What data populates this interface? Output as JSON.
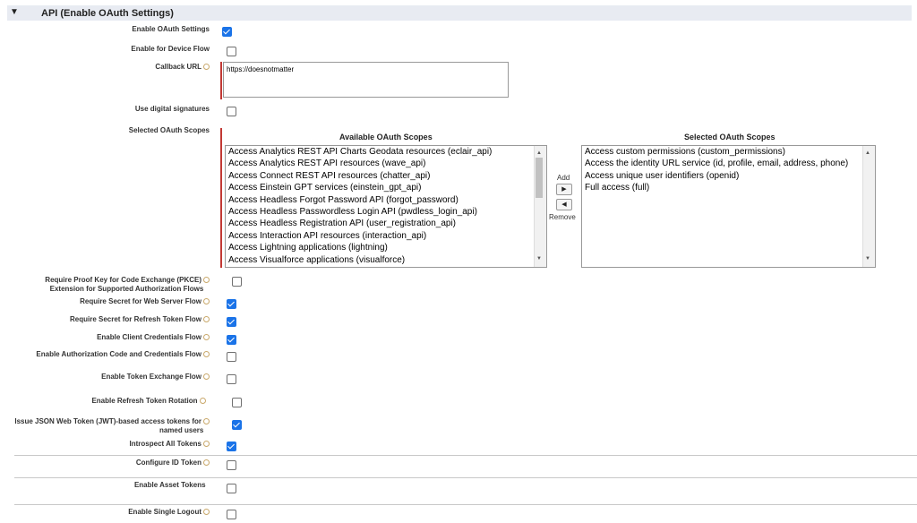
{
  "section": {
    "title": "API (Enable OAuth Settings)",
    "toggle": "▼"
  },
  "fields": {
    "enable_oauth": {
      "label": "Enable OAuth Settings",
      "checked": true
    },
    "device_flow": {
      "label": "Enable for Device Flow",
      "checked": false
    },
    "callback_url": {
      "label": "Callback URL",
      "value": "https://doesnotmatter"
    },
    "digital_sig": {
      "label": "Use digital signatures",
      "checked": false
    },
    "scopes_label": "Selected OAuth Scopes",
    "pkce": {
      "label1": "Require Proof Key for Code Exchange (PKCE)",
      "label2": "Extension for Supported Authorization Flows",
      "checked": false
    },
    "secret_web": {
      "label": "Require Secret for Web Server Flow",
      "checked": true
    },
    "secret_refresh": {
      "label": "Require Secret for Refresh Token Flow",
      "checked": true
    },
    "client_creds": {
      "label": "Enable Client Credentials Flow",
      "checked": true
    },
    "auth_code_creds": {
      "label": "Enable Authorization Code and Credentials Flow",
      "checked": false
    },
    "token_exchange": {
      "label": "Enable Token Exchange Flow",
      "checked": false
    },
    "refresh_rotation": {
      "label": "Enable Refresh Token Rotation",
      "checked": false
    },
    "jwt": {
      "label1": "Issue JSON Web Token (JWT)-based access tokens for",
      "label2": "named users",
      "checked": true
    },
    "introspect": {
      "label": "Introspect All Tokens",
      "checked": true
    },
    "id_token": {
      "label": "Configure ID Token",
      "checked": false
    },
    "asset_tokens": {
      "label": "Enable Asset Tokens",
      "checked": false
    },
    "single_logout": {
      "label": "Enable Single Logout",
      "checked": false
    }
  },
  "scopes": {
    "available_title": "Available OAuth Scopes",
    "selected_title": "Selected OAuth Scopes",
    "add_label": "Add",
    "remove_label": "Remove",
    "available": [
      "Access Analytics REST API Charts Geodata resources (eclair_api)",
      "Access Analytics REST API resources (wave_api)",
      "Access Connect REST API resources (chatter_api)",
      "Access Einstein GPT services (einstein_gpt_api)",
      "Access Headless Forgot Password API (forgot_password)",
      "Access Headless Passwordless Login API (pwdless_login_api)",
      "Access Headless Registration API (user_registration_api)",
      "Access Interaction API resources (interaction_api)",
      "Access Lightning applications (lightning)",
      "Access Visualforce applications (visualforce)"
    ],
    "selected": [
      "Access custom permissions (custom_permissions)",
      "Access the identity URL service (id, profile, email, address, phone)",
      "Access unique user identifiers (openid)",
      "Full access (full)"
    ]
  }
}
